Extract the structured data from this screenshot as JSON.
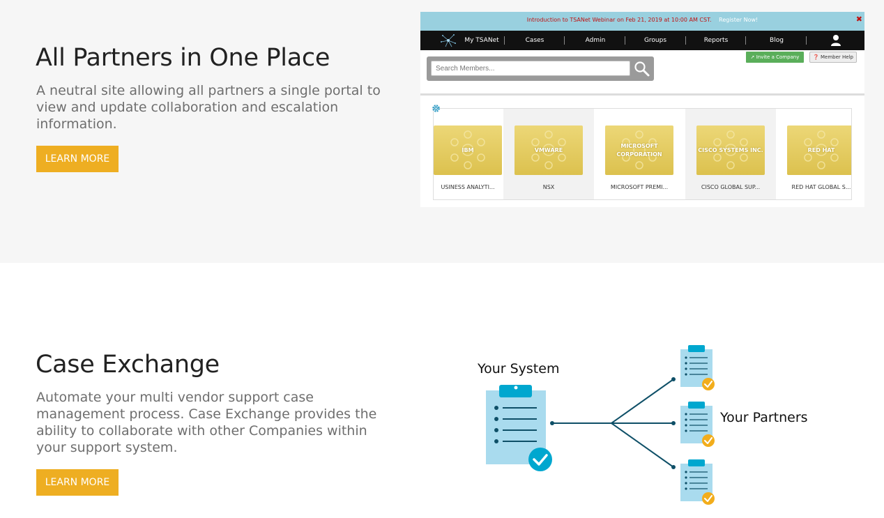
{
  "section1": {
    "title": "All Partners in One Place",
    "description": "A neutral site allowing all partners a single portal to view and update collaboration and escalation information.",
    "button_label": "LEARN MORE",
    "portal": {
      "banner_text": "Introduction to TSANet Webinar on Feb 21, 2019 at 10:00 AM CST.",
      "banner_link": "Register Now!",
      "banner_close": "✖",
      "nav": [
        "My TSANet",
        "Cases",
        "Admin",
        "Groups",
        "Reports",
        "Blog"
      ],
      "search_placeholder": "Search Members...",
      "invite_label": "Invite a Company",
      "help_label": "Member Help",
      "cards": [
        {
          "name": "IBM",
          "caption": "USINESS ANALYTI..."
        },
        {
          "name": "VMWARE",
          "caption": "NSX"
        },
        {
          "name": "MICROSOFT CORPORATION",
          "caption": "MICROSOFT PREMI..."
        },
        {
          "name": "CISCO SYSTEMS INC.",
          "caption": "CISCO GLOBAL SUP..."
        },
        {
          "name": "RED HAT",
          "caption": "RED HAT GLOBAL S..."
        }
      ]
    }
  },
  "section2": {
    "title": "Case Exchange",
    "description": "Automate your multi vendor support case management process. Case Exchange provides the ability to collaborate with other Companies within your support system.",
    "button_label": "LEARN MORE",
    "diagram": {
      "source_label": "Your System",
      "target_label": "Your Partners"
    }
  },
  "colors": {
    "accent": "#eeae22",
    "clipboard": "#a9dbee",
    "clipboard_dark": "#00a7cf",
    "check_gold": "#f2ad1c",
    "check_teal": "#00a7cf",
    "line": "#0e4f67"
  }
}
